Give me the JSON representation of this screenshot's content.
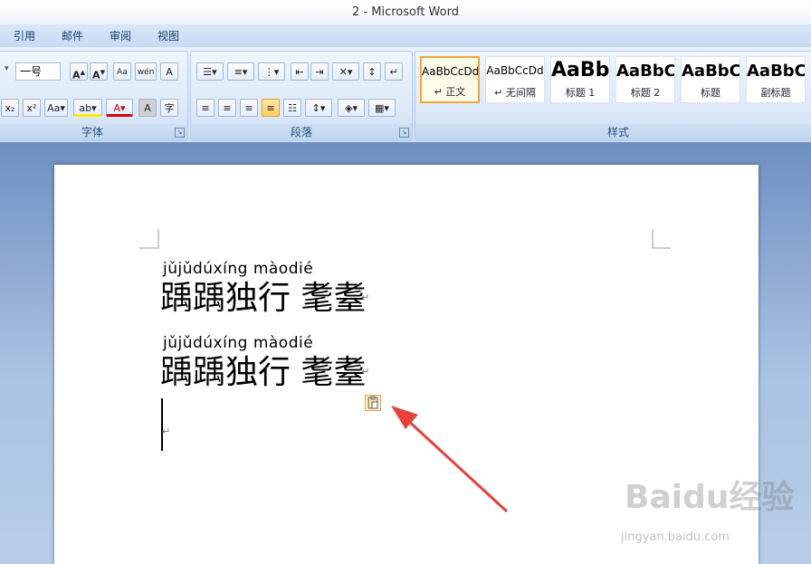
{
  "window": {
    "title": "2 - Microsoft Word"
  },
  "tabs": [
    "引用",
    "邮件",
    "审阅",
    "视图"
  ],
  "font_group": {
    "label": "字体",
    "size_value": "一号"
  },
  "paragraph_group": {
    "label": "段落"
  },
  "styles_group": {
    "label": "样式",
    "items": [
      {
        "sample": "AaBbCcDd",
        "name": "↵ 正文"
      },
      {
        "sample": "AaBbCcDd",
        "name": "↵ 无间隔"
      },
      {
        "sample": "AaBb",
        "name": "标题 1"
      },
      {
        "sample": "AaBbC",
        "name": "标题 2"
      },
      {
        "sample": "AaBbC",
        "name": "标题"
      },
      {
        "sample": "AaBbC",
        "name": "副标题"
      }
    ]
  },
  "document": {
    "lines": [
      {
        "pinyin": "jǔjǔdúxíng  màodié",
        "hanzi": "踽踽独行 耄耋"
      },
      {
        "pinyin": "jǔjǔdúxíng  màodié",
        "hanzi": "踽踽独行 耄耋"
      }
    ],
    "paragraph_mark": "↵"
  },
  "watermark": {
    "text": "Baidu经验",
    "url": "jingyan.baidu.com"
  },
  "colors": {
    "accent": "#f0a830",
    "arrow": "#e8403a"
  }
}
